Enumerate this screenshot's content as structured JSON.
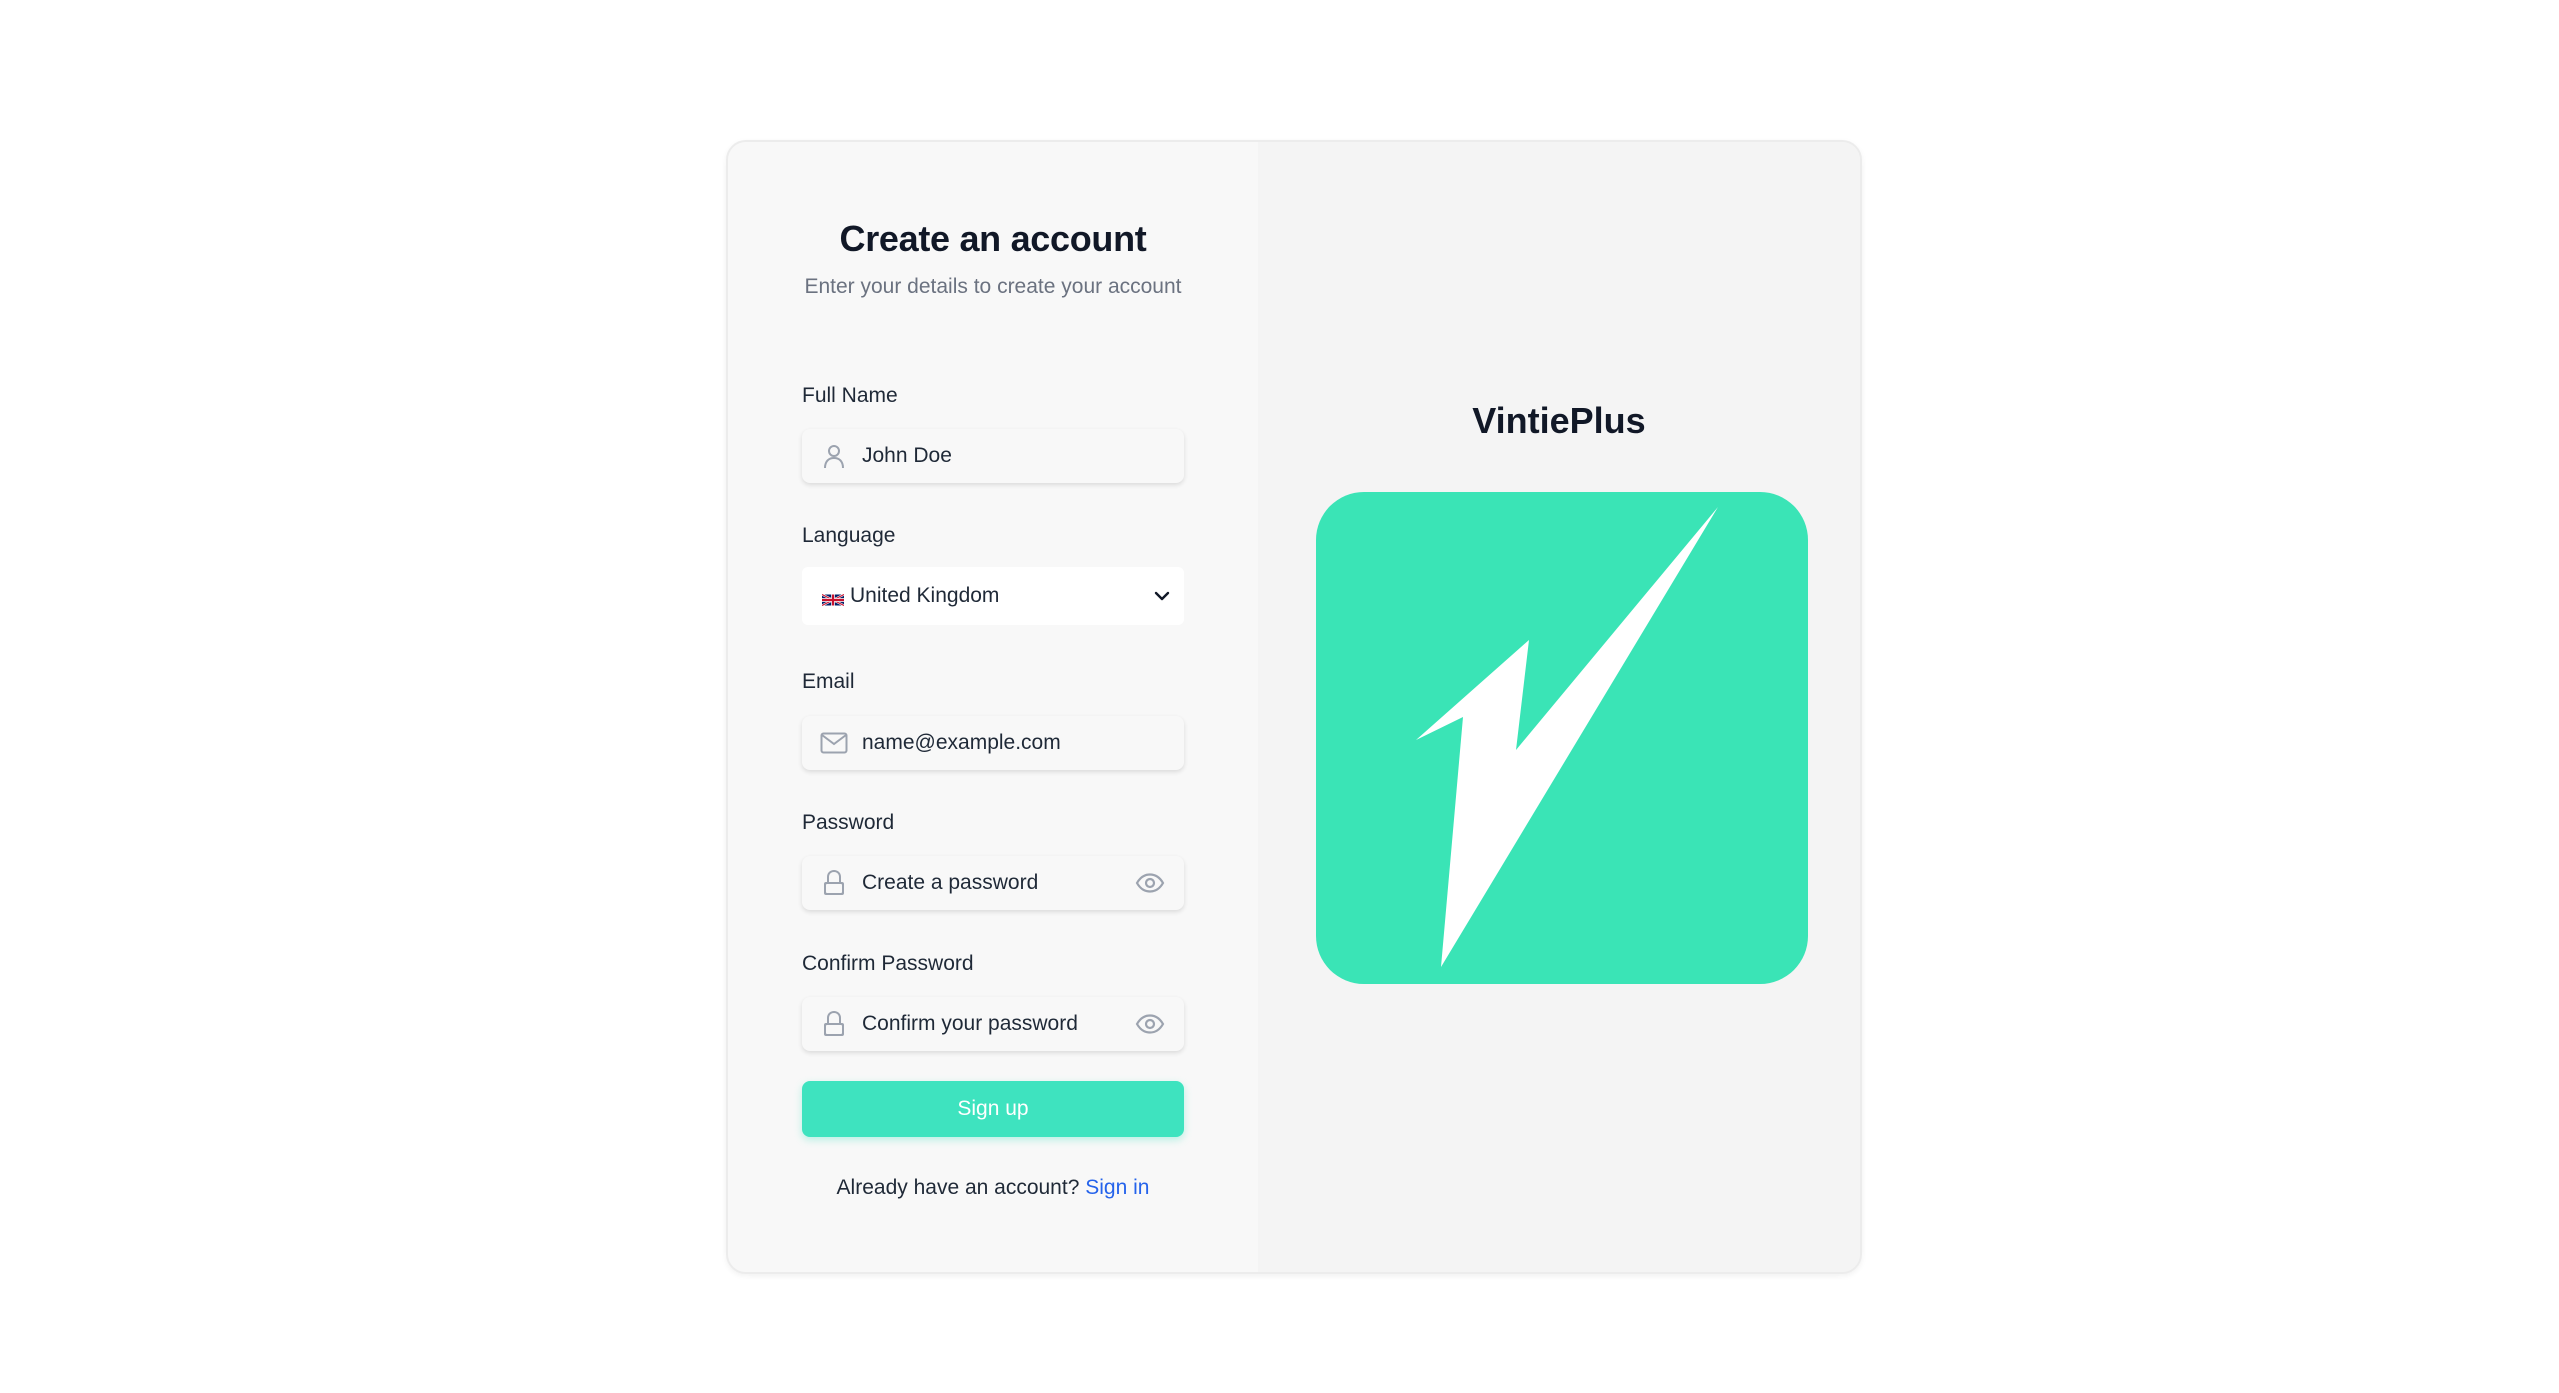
{
  "form": {
    "title": "Create an account",
    "subtitle": "Enter your details to create your account",
    "full_name": {
      "label": "Full Name",
      "placeholder": "John Doe",
      "icon": "user-icon"
    },
    "language": {
      "label": "Language",
      "selected": "United Kingdom",
      "flag": "uk-flag-icon"
    },
    "email": {
      "label": "Email",
      "placeholder": "name@example.com",
      "icon": "mail-icon"
    },
    "password": {
      "label": "Password",
      "placeholder": "Create a password",
      "icon": "lock-icon"
    },
    "confirm_password": {
      "label": "Confirm Password",
      "placeholder": "Confirm your password",
      "icon": "lock-icon"
    },
    "submit_label": "Sign up",
    "signin_prompt": "Already have an account?",
    "signin_link": "Sign in"
  },
  "brand": {
    "name": "VintiePlus",
    "logo": "lightning-bolt-logo"
  },
  "colors": {
    "accent": "#3ee3bf",
    "logo_bg": "#3ae4b6",
    "link": "#2563eb",
    "muted": "#6b7280"
  }
}
